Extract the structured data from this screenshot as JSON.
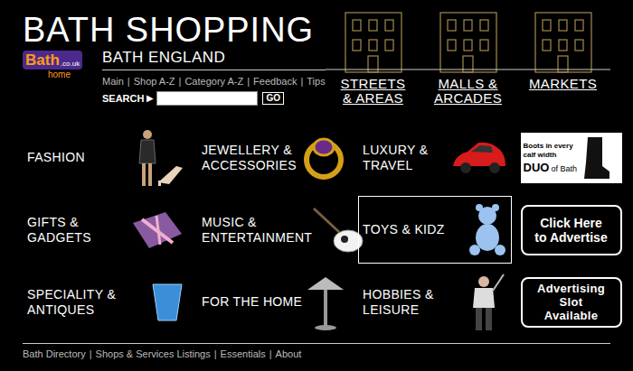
{
  "site": {
    "title": "BATH SHOPPING",
    "subtitle": "BATH ENGLAND",
    "logo": {
      "text": "Bath",
      "suffix": ".co.uk",
      "home": "home"
    }
  },
  "nav": {
    "separator": "|",
    "items": [
      {
        "label": "Main"
      },
      {
        "label": "Shop A-Z"
      },
      {
        "label": "Category A-Z"
      },
      {
        "label": "Feedback"
      },
      {
        "label": "Tips"
      }
    ]
  },
  "search": {
    "label": "SEARCH",
    "arrow": "▶",
    "value": "",
    "button": "GO"
  },
  "areas": [
    {
      "lines": [
        "STREETS",
        "& AREAS"
      ]
    },
    {
      "lines": [
        "MALLS &",
        "ARCADES"
      ]
    },
    {
      "lines": [
        "MARKETS"
      ]
    }
  ],
  "categories": [
    {
      "lines": [
        "FASHION"
      ],
      "selected": false
    },
    {
      "lines": [
        "JEWELLERY &",
        "ACCESSORIES"
      ],
      "selected": false
    },
    {
      "lines": [
        "LUXURY &",
        "TRAVEL"
      ],
      "selected": false
    },
    {
      "lines": [
        "GIFTS &",
        "GADGETS"
      ],
      "selected": false
    },
    {
      "lines": [
        "MUSIC &",
        "ENTERTAINMENT"
      ],
      "selected": false
    },
    {
      "lines": [
        "TOYS & KIDZ"
      ],
      "selected": true
    },
    {
      "lines": [
        "SPECIALITY &",
        "ANTIQUES"
      ],
      "selected": false
    },
    {
      "lines": [
        "FOR THE HOME"
      ],
      "selected": false
    },
    {
      "lines": [
        "HOBBIES &",
        "LEISURE"
      ],
      "selected": false
    }
  ],
  "ads": [
    {
      "kind": "banner",
      "lines": [
        "Boots in every",
        "calf width"
      ],
      "brand": "DUO",
      "brand_sub": "of Bath"
    },
    {
      "kind": "button",
      "lines": [
        "Click Here",
        "to Advertise"
      ]
    },
    {
      "kind": "slot",
      "lines": [
        "Advertising",
        "Slot",
        "Available"
      ]
    }
  ],
  "footer": {
    "separator": "|",
    "links": [
      {
        "label": "Bath Directory"
      },
      {
        "label": "Shops & Services Listings"
      },
      {
        "label": "Essentials"
      },
      {
        "label": "About"
      }
    ]
  }
}
